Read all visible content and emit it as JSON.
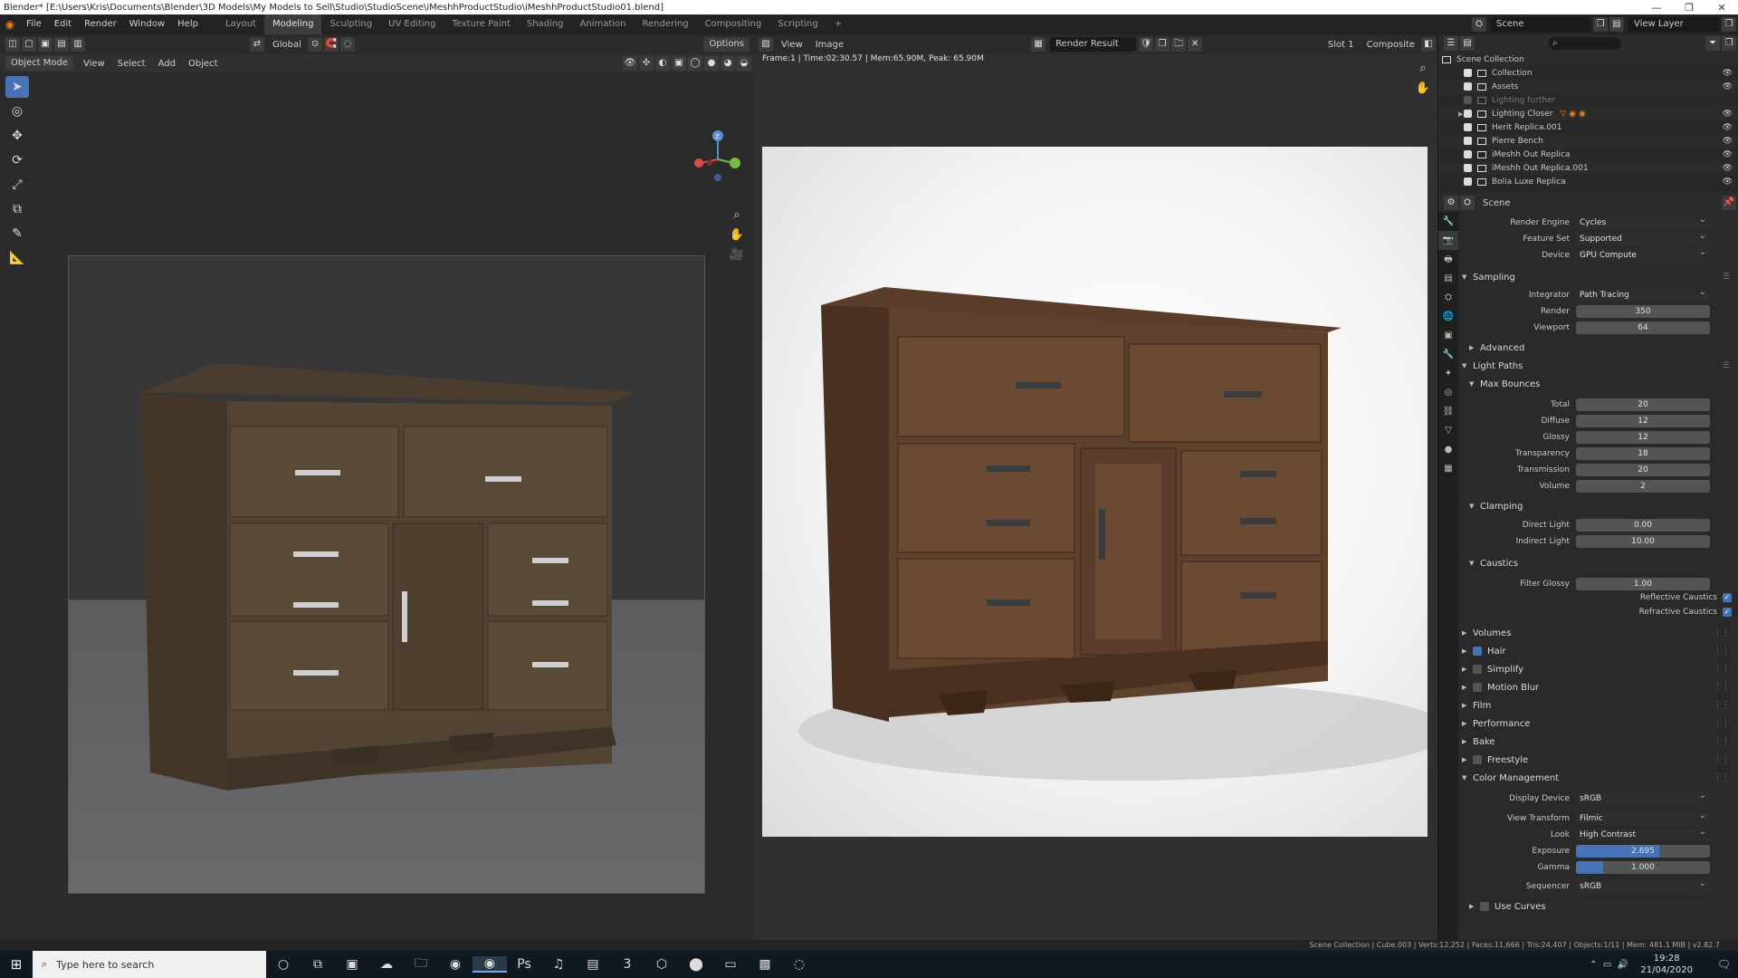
{
  "window": {
    "title": "Blender* [E:\\Users\\Kris\\Documents\\Blender\\3D Models\\My Models to Sell\\Studio\\StudioScene\\iMeshhProductStudio\\iMeshhProductStudio01.blend]",
    "minimize": "—",
    "restore": "❐",
    "close": "✕"
  },
  "menu": [
    "File",
    "Edit",
    "Render",
    "Window",
    "Help"
  ],
  "workspaces": [
    "Layout",
    "Modeling",
    "Sculpting",
    "UV Editing",
    "Texture Paint",
    "Shading",
    "Animation",
    "Rendering",
    "Compositing",
    "Scripting",
    "+"
  ],
  "active_workspace": "Modeling",
  "topright": {
    "scene": "Scene",
    "view_layer": "View Layer"
  },
  "viewport": {
    "transform": "Global",
    "options": "Options",
    "mode": "Object Mode",
    "menus": [
      "View",
      "Select",
      "Add",
      "Object"
    ],
    "tools": [
      "select-box-icon",
      "cursor-icon",
      "move-icon",
      "rotate-icon",
      "scale-icon",
      "transform-icon",
      "annotate-icon",
      "measure-icon"
    ],
    "tool_glyphs": [
      "➤",
      "◎",
      "✥",
      "⟳",
      "⤢",
      "⧉",
      "✎",
      "📐"
    ],
    "gizmo": {
      "z": "Z"
    }
  },
  "image_editor": {
    "menus": [
      "View",
      "Image"
    ],
    "image_name": "Render Result",
    "slot": "Slot 1",
    "layer": "Composite",
    "info": "Frame:1 | Time:02:30.57 | Mem:65.90M, Peak: 65.90M"
  },
  "outliner": {
    "root": "Scene Collection",
    "items": [
      {
        "name": "Collection",
        "checked": true,
        "dim": false,
        "expand": false
      },
      {
        "name": "Assets",
        "checked": true,
        "dim": false,
        "expand": false
      },
      {
        "name": "Lighting further",
        "checked": false,
        "dim": true,
        "expand": false
      },
      {
        "name": "Lighting Closer",
        "checked": true,
        "dim": false,
        "expand": true
      },
      {
        "name": "Herit Replica.001",
        "checked": true,
        "dim": false,
        "expand": false
      },
      {
        "name": "Pierre Bench",
        "checked": true,
        "dim": false,
        "expand": false
      },
      {
        "name": "iMeshh Out Replica",
        "checked": true,
        "dim": false,
        "expand": false
      },
      {
        "name": "iMeshh Out Replica.001",
        "checked": true,
        "dim": false,
        "expand": false
      },
      {
        "name": "Bolia Luxe Replica",
        "checked": true,
        "dim": false,
        "expand": false
      }
    ]
  },
  "properties": {
    "context": "Scene",
    "render_engine": {
      "label": "Render Engine",
      "value": "Cycles"
    },
    "feature_set": {
      "label": "Feature Set",
      "value": "Supported"
    },
    "device": {
      "label": "Device",
      "value": "GPU Compute"
    },
    "sampling": {
      "title": "Sampling",
      "integrator": {
        "label": "Integrator",
        "value": "Path Tracing"
      },
      "render": {
        "label": "Render",
        "value": "350"
      },
      "viewport": {
        "label": "Viewport",
        "value": "64"
      },
      "advanced": "Advanced"
    },
    "light_paths": {
      "title": "Light Paths",
      "max_bounces": "Max Bounces",
      "total": {
        "label": "Total",
        "value": "20"
      },
      "diffuse": {
        "label": "Diffuse",
        "value": "12"
      },
      "glossy": {
        "label": "Glossy",
        "value": "12"
      },
      "transparency": {
        "label": "Transparency",
        "value": "18"
      },
      "transmission": {
        "label": "Transmission",
        "value": "20"
      },
      "volume": {
        "label": "Volume",
        "value": "2"
      },
      "clamping": "Clamping",
      "direct_light": {
        "label": "Direct Light",
        "value": "0.00"
      },
      "indirect_light": {
        "label": "Indirect Light",
        "value": "10.00"
      },
      "caustics": "Caustics",
      "filter_glossy": {
        "label": "Filter Glossy",
        "value": "1.00"
      },
      "reflective_caustics": "Reflective Caustics",
      "refractive_caustics": "Refractive Caustics"
    },
    "panels": [
      {
        "name": "Volumes",
        "checkbox": false,
        "checked": false
      },
      {
        "name": "Hair",
        "checkbox": true,
        "checked": true
      },
      {
        "name": "Simplify",
        "checkbox": true,
        "checked": false
      },
      {
        "name": "Motion Blur",
        "checkbox": true,
        "checked": false
      },
      {
        "name": "Film",
        "checkbox": false,
        "checked": false
      },
      {
        "name": "Performance",
        "checkbox": false,
        "checked": false
      },
      {
        "name": "Bake",
        "checkbox": false,
        "checked": false
      },
      {
        "name": "Freestyle",
        "checkbox": true,
        "checked": false
      }
    ],
    "color_management": {
      "title": "Color Management",
      "display_device": {
        "label": "Display Device",
        "value": "sRGB"
      },
      "view_transform": {
        "label": "View Transform",
        "value": "Filmic"
      },
      "look": {
        "label": "Look",
        "value": "High Contrast"
      },
      "exposure": {
        "label": "Exposure",
        "value": "2.695",
        "fill": 0.62
      },
      "gamma": {
        "label": "Gamma",
        "value": "1.000",
        "fill": 0.2
      },
      "sequencer": {
        "label": "Sequencer",
        "value": "sRGB"
      },
      "use_curves": "Use Curves"
    }
  },
  "status": "Scene Collection | Cube.003 | Verts:12,252 | Faces:11,666 | Tris:24,407 | Objects:1/11 | Mem: 481.1 MiB | v2.82.7",
  "taskbar": {
    "search_placeholder": "Type here to search",
    "time": "19:28",
    "date": "21/04/2020"
  },
  "colors": {
    "accent": "#4772b3",
    "blender_orange": "#e87d0d"
  }
}
